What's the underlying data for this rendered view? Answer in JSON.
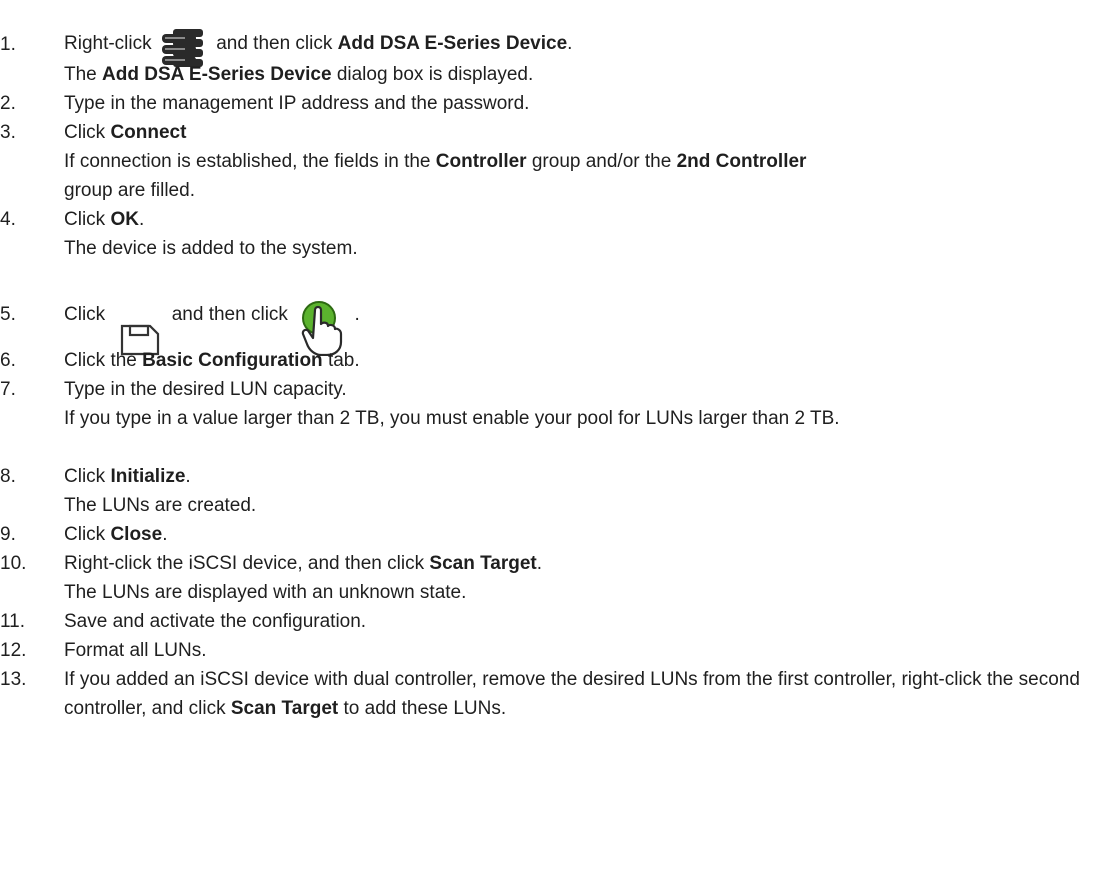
{
  "icons": {
    "storage_device": "storage-device-icon",
    "save": "save-icon",
    "activate": "activate-hand-icon"
  },
  "colors": {
    "activate_green": "#5bb32e",
    "text": "#1f1f1f"
  },
  "steps": [
    {
      "num": "1.",
      "a": "Right-click",
      "b": "and then click",
      "c": "Add DSA E-Series Device",
      "d": ".",
      "r1": "The",
      "r2": "Add DSA E-Series Device",
      "r3": "dialog box is displayed."
    },
    {
      "num": "2.",
      "a": "Type in the management IP address and the password."
    },
    {
      "num": "3.",
      "a": "Click",
      "b": "Connect",
      "r1": "If connection is established, the fields in the",
      "r2": "Controller",
      "r3": "group and/or the",
      "r4": "2nd Controller",
      "r5": "group are filled."
    },
    {
      "num": "4.",
      "a": "Click",
      "b": "OK",
      "c": ".",
      "r1": "The device is added to the system."
    },
    {
      "num": "5.",
      "a": "Click",
      "b": "and then click",
      "c": "."
    },
    {
      "num": "6.",
      "a": "Click the",
      "b": "Basic Configuration",
      "c": "tab."
    },
    {
      "num": "7.",
      "a": "Type in the desired LUN capacity.",
      "r1": "If you type in a value larger than 2 TB, you must enable your pool for LUNs larger than 2 TB."
    },
    {
      "num": "8.",
      "a": "Click",
      "b": "Initialize",
      "c": ".",
      "r1": "The LUNs are created."
    },
    {
      "num": "9.",
      "a": "Click",
      "b": "Close",
      "c": "."
    },
    {
      "num": "10.",
      "a": "Right-click the iSCSI device, and then click",
      "b": "Scan Target",
      "c": ".",
      "r1": "The LUNs are displayed with an unknown state."
    },
    {
      "num": "11.",
      "a": "Save and activate the configuration."
    },
    {
      "num": "12.",
      "a": "Format all LUNs."
    },
    {
      "num": "13.",
      "a": "If you added an iSCSI device with dual controller, remove the desired LUNs from the first controller, right-click the second controller, and click",
      "b": "Scan Target",
      "c": "to add these LUNs."
    }
  ]
}
